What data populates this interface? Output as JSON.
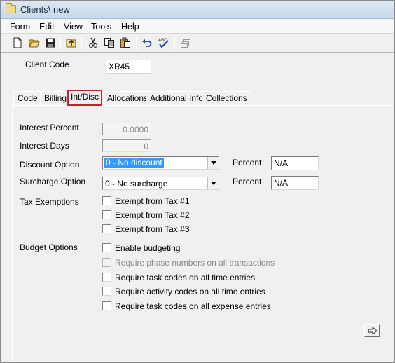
{
  "window": {
    "title": "Clients\\ new"
  },
  "menu": {
    "items": [
      "Form",
      "Edit",
      "View",
      "Tools",
      "Help"
    ]
  },
  "toolbar": {
    "buttons": [
      "new-document-icon",
      "open-folder-icon",
      "save-icon",
      "up-folder-icon",
      "cut-icon",
      "copy-icon",
      "paste-icon",
      "undo-icon",
      "spellcheck-icon",
      "layers-icon"
    ]
  },
  "client_code": {
    "label": "Client Code",
    "value": "XR45"
  },
  "tabs": [
    "Code",
    "Billing",
    "Int/Disc",
    "Allocations",
    "Additional Info",
    "Collections"
  ],
  "active_tab": "Int/Disc",
  "form": {
    "interest_percent": {
      "label": "Interest Percent",
      "value": "0.0000"
    },
    "interest_days": {
      "label": "Interest Days",
      "value": "0"
    },
    "discount_option": {
      "label": "Discount Option",
      "value": "0 - No discount",
      "percent_label": "Percent",
      "percent_value": "N/A"
    },
    "surcharge_option": {
      "label": "Surcharge Option",
      "value": "0 - No surcharge",
      "percent_label": "Percent",
      "percent_value": "N/A"
    },
    "tax_exemptions": {
      "label": "Tax Exemptions",
      "options": [
        {
          "label": "Exempt from Tax #1",
          "checked": false
        },
        {
          "label": "Exempt from Tax #2",
          "checked": false
        },
        {
          "label": "Exempt from Tax #3",
          "checked": false
        }
      ]
    },
    "budget_options": {
      "label": "Budget Options",
      "options": [
        {
          "label": "Enable budgeting",
          "checked": false,
          "enabled": true
        },
        {
          "label": "Require phase numbers on all transactions",
          "checked": false,
          "enabled": false
        },
        {
          "label": "Require task codes on all time entries",
          "checked": false,
          "enabled": true
        },
        {
          "label": "Require activity codes on all time entries",
          "checked": false,
          "enabled": true
        },
        {
          "label": "Require task codes on all expense entries",
          "checked": false,
          "enabled": true
        }
      ]
    }
  },
  "colors": {
    "active_tab_outline": "#c0272d",
    "selection": "#3399ff"
  }
}
